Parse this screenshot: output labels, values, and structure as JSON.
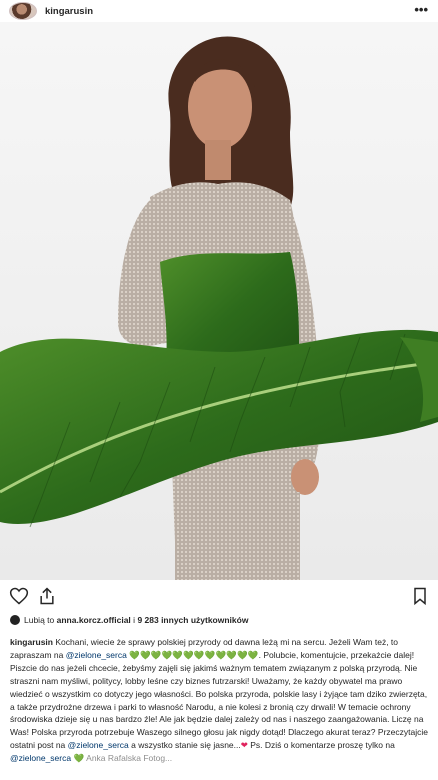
{
  "header": {
    "username": "kingarusin",
    "more_icon": "more-horizontal-icon"
  },
  "photo": {
    "description_icon": "post-photo"
  },
  "actions": {
    "like_icon": "heart-icon",
    "share_icon": "share-icon",
    "save_icon": "bookmark-icon"
  },
  "likes": {
    "prefix": "Lubią to",
    "first_user": "anna.korcz.official",
    "connector": "i",
    "count_text": "9 283 innych użytkowników"
  },
  "caption": {
    "username": "kingarusin",
    "part1": "Kochani, wiecie że sprawy polskiej przyrody od dawna leżą mi na sercu. Jeżeli Wam też, to zapraszam na",
    "tag1": "@zielone_serca",
    "hearts1": "💚💚💚💚💚💚💚💚💚💚💚💚",
    "part2": ". Polubcie, komentujcie, przekażcie dalej! Piszcie do nas jeżeli chcecie, żebyśmy zajęli się jakimś ważnym tematem związanym z polską przyrodą. Nie straszni nam myśliwi, politycy, lobby leśne czy biznes futrzarski! Uważamy, że każdy obywatel ma prawo wiedzieć o wszystkim co dotyczy jego własności. Bo polska przyroda, polskie lasy i żyjące tam dziko zwierzęta, a także przydrożne drzewa i parki to własność Narodu, a nie kolesi z bronią czy drwali! W temacie ochrony środowiska dzieje się u nas bardzo źle! Ale jak będzie dalej zależy od nas i naszego zaangażowania. Liczę na Was! Polska przyroda potrzebuje Waszego silnego głosu jak nigdy dotąd! Dlaczego akurat teraz? Przeczytajcie ostatni post na",
    "tag2": "@zielone_serca",
    "part3": "a wszystko stanie się jasne...",
    "red_heart": "❤",
    "part4": "Ps. Dziś o komentarze proszę tylko na",
    "tag3": "@zielone_serca",
    "hearts2": "💚",
    "cut_line": "Anka Rafalska Fotog..."
  },
  "colors": {
    "text": "#262626",
    "link": "#00376b",
    "green_heart": "#1bbf2e",
    "red_heart": "#e0245e",
    "leaf": "#2f6e1e"
  }
}
